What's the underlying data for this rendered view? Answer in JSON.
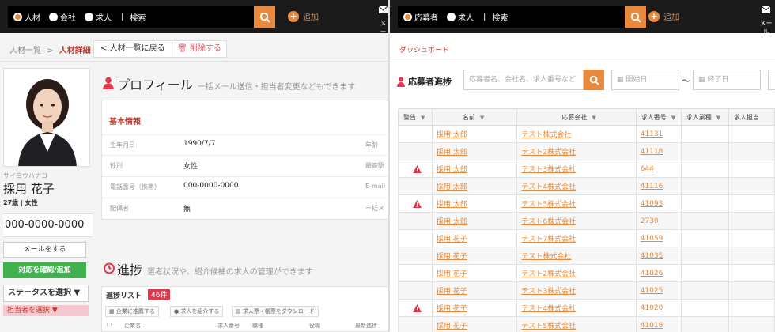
{
  "left": {
    "search": {
      "radios": [
        {
          "label": "人材",
          "on": true
        },
        {
          "label": "会社",
          "on": false
        },
        {
          "label": "求人",
          "on": false
        }
      ],
      "keyword": "検索"
    },
    "add_label": "追加",
    "mail_label": "メール",
    "breadcrumb": {
      "parent": "人材一覧",
      "sep": ">",
      "current": "人材詳細"
    },
    "back_button": "人材一覧に戻る",
    "delete_button": "削除する",
    "person": {
      "kana": "サイヨウハナコ",
      "name": "採用 花子",
      "meta": "27歳 | 女性",
      "phone": "000-0000-0000"
    },
    "mail_button": "メールをする",
    "confirm_button": "対応を確認/追加",
    "status_select": "ステータスを選択 ▼",
    "owner_select": "担当者を選択 ▼",
    "profile": {
      "title": "プロフィール",
      "subtitle": "一括メール送信・担当者変更などもできます",
      "basic_info": "基本情報",
      "rows": [
        {
          "key": "生年月日",
          "value": "1990/7/7",
          "key2": "年齢"
        },
        {
          "key": "性別",
          "value": "女性",
          "key2": "最寄駅"
        },
        {
          "key": "電話番号（携帯）",
          "value": "000-0000-0000",
          "key2": "E-mail"
        },
        {
          "key": "配偶者",
          "value": "無",
          "key2": "一括メ"
        }
      ]
    },
    "progress": {
      "title": "進捗",
      "subtitle": "選考状況や、紹介候補の求人の管理ができます",
      "list_label": "進捗リスト",
      "count": "46件",
      "buttons": [
        "企業に推薦する",
        "求人を紹介する",
        "求人票・帳票をダウンロード"
      ],
      "headers": [
        "企業名",
        "求人番号",
        "職種",
        "役職",
        "最新進捗"
      ]
    }
  },
  "right": {
    "search": {
      "radios": [
        {
          "label": "応募者",
          "on": true
        },
        {
          "label": "求人",
          "on": false
        }
      ],
      "keyword": "検索"
    },
    "add_label": "追加",
    "mail_label": "メール",
    "dashboard": "ダッシュボード",
    "section_title": "応募者進捗",
    "filter_placeholder": "応募者名、会社名、求人番号など",
    "start_date": "開始日",
    "tilde": "〜",
    "end_date": "終了日",
    "columns": [
      "警告",
      "名前",
      "応募会社",
      "求人番号",
      "求人業種",
      "求人担当"
    ],
    "rows": [
      {
        "warn": false,
        "name": "採用 太郎",
        "company": "テスト株式会社",
        "job": "41131"
      },
      {
        "warn": false,
        "name": "採用 太郎",
        "company": "テスト2株式会社",
        "job": "41118"
      },
      {
        "warn": true,
        "name": "採用 太郎",
        "company": "テスト3株式会社",
        "job": "644"
      },
      {
        "warn": false,
        "name": "採用 太郎",
        "company": "テスト4株式会社",
        "job": "41116"
      },
      {
        "warn": true,
        "name": "採用 太郎",
        "company": "テスト5株式会社",
        "job": "41093"
      },
      {
        "warn": false,
        "name": "採用 太郎",
        "company": "テスト6株式会社",
        "job": "2730"
      },
      {
        "warn": false,
        "name": "採用 花子",
        "company": "テスト7株式会社",
        "job": "41059"
      },
      {
        "warn": false,
        "name": "採用 花子",
        "company": "テスト株式会社",
        "job": "41035"
      },
      {
        "warn": false,
        "name": "採用 花子",
        "company": "テスト2株式会社",
        "job": "41026"
      },
      {
        "warn": false,
        "name": "採用 花子",
        "company": "テスト3株式会社",
        "job": "41025"
      },
      {
        "warn": true,
        "name": "採用 花子",
        "company": "テスト4株式会社",
        "job": "41020"
      },
      {
        "warn": false,
        "name": "採用 花子",
        "company": "テスト5株式会社",
        "job": "41018"
      }
    ]
  },
  "colors": {
    "accent": "#e8893c",
    "alert": "#e0384f",
    "green": "#3fb24f",
    "topbar": "#1a1a1a"
  }
}
